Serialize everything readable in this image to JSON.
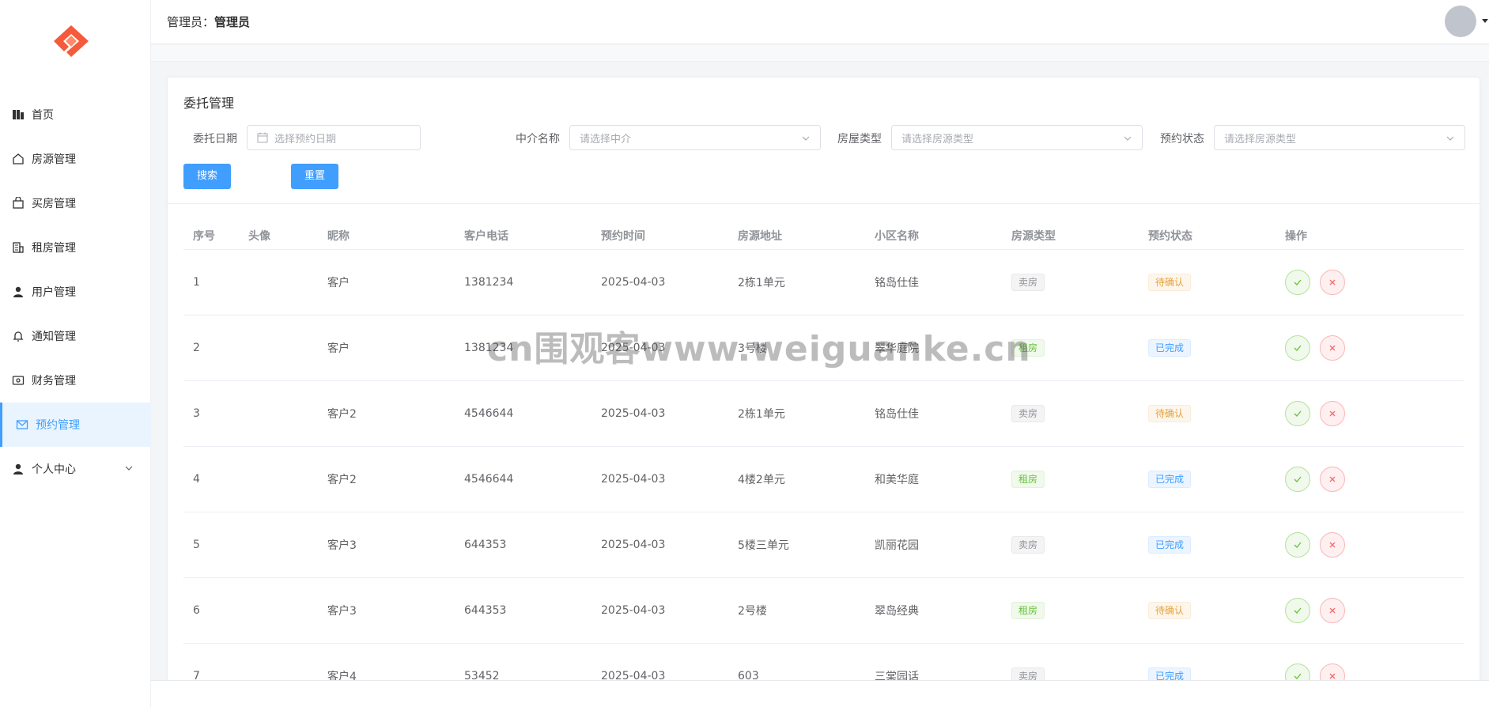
{
  "header": {
    "admin_prefix": "管理员：",
    "admin_name": "管理员"
  },
  "sidebar": {
    "items": [
      {
        "label": "首页",
        "icon": "dashboard-icon"
      },
      {
        "label": "房源管理",
        "icon": "house-icon"
      },
      {
        "label": "买房管理",
        "icon": "shopping-bag-icon"
      },
      {
        "label": "租房管理",
        "icon": "office-building-icon"
      },
      {
        "label": "用户管理",
        "icon": "user-icon"
      },
      {
        "label": "通知管理",
        "icon": "bell-icon"
      },
      {
        "label": "财务管理",
        "icon": "wallet-icon"
      },
      {
        "label": "预约管理",
        "icon": "message-icon",
        "active": true
      },
      {
        "label": "个人中心",
        "icon": "user-icon",
        "expandable": true
      }
    ]
  },
  "page": {
    "title": "委托管理"
  },
  "filters": {
    "date_label": "委托日期",
    "date_placeholder": "选择预约日期",
    "agent_label": "中介名称",
    "agent_placeholder": "请选择中介",
    "house_type_label": "房屋类型",
    "house_type_placeholder": "请选择房源类型",
    "status_label": "预约状态",
    "status_placeholder": "请选择房源类型",
    "search_label": "搜索",
    "reset_label": "重置"
  },
  "table": {
    "columns": [
      "序号",
      "头像",
      "昵称",
      "客户电话",
      "预约时间",
      "房源地址",
      "小区名称",
      "房源类型",
      "预约状态",
      "操作"
    ],
    "rows": [
      {
        "no": "1",
        "nickname": "客户",
        "phone": "1381234",
        "time": "2025-04-03",
        "address": "2栋1单元",
        "community": "铭岛仕佳",
        "type": "卖房",
        "type_kind": "sell",
        "status": "待确认",
        "status_kind": "pending"
      },
      {
        "no": "2",
        "nickname": "客户",
        "phone": "1381234",
        "time": "2025-04-03",
        "address": "3号楼",
        "community": "翠华庭院",
        "type": "租房",
        "type_kind": "rent",
        "status": "已完成",
        "status_kind": "done"
      },
      {
        "no": "3",
        "nickname": "客户2",
        "phone": "4546644",
        "time": "2025-04-03",
        "address": "2栋1单元",
        "community": "铭岛仕佳",
        "type": "卖房",
        "type_kind": "sell",
        "status": "待确认",
        "status_kind": "pending"
      },
      {
        "no": "4",
        "nickname": "客户2",
        "phone": "4546644",
        "time": "2025-04-03",
        "address": "4楼2单元",
        "community": "和美华庭",
        "type": "租房",
        "type_kind": "rent",
        "status": "已完成",
        "status_kind": "done"
      },
      {
        "no": "5",
        "nickname": "客户3",
        "phone": "644353",
        "time": "2025-04-03",
        "address": "5楼三单元",
        "community": "凯丽花园",
        "type": "卖房",
        "type_kind": "sell",
        "status": "已完成",
        "status_kind": "done"
      },
      {
        "no": "6",
        "nickname": "客户3",
        "phone": "644353",
        "time": "2025-04-03",
        "address": "2号楼",
        "community": "翠岛经典",
        "type": "租房",
        "type_kind": "rent",
        "status": "待确认",
        "status_kind": "pending"
      },
      {
        "no": "7",
        "nickname": "客户4",
        "phone": "53452",
        "time": "2025-04-03",
        "address": "603",
        "community": "三棠园话",
        "type": "卖房",
        "type_kind": "sell",
        "status": "已完成",
        "status_kind": "done"
      }
    ]
  },
  "watermark": "cn围观客www.weiguanke.cn"
}
